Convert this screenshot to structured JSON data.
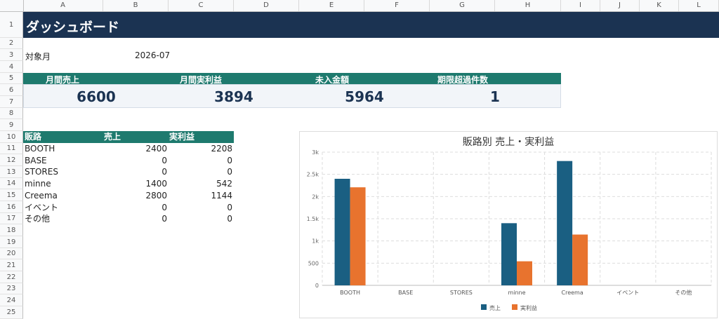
{
  "columns": [
    "A",
    "B",
    "C",
    "D",
    "E",
    "F",
    "G",
    "H",
    "I",
    "J",
    "K",
    "L"
  ],
  "rows": [
    "1",
    "2",
    "3",
    "4",
    "5",
    "6",
    "7",
    "8",
    "9",
    "10",
    "11",
    "12",
    "13",
    "14",
    "15",
    "16",
    "17",
    "18",
    "19",
    "20",
    "21",
    "22",
    "23",
    "24",
    "25"
  ],
  "dashboard": {
    "title": "ダッシュボード",
    "month_label": "対象月",
    "month_value": "2026-07"
  },
  "kpis": [
    {
      "label": "月間売上",
      "value": "6600"
    },
    {
      "label": "月間実利益",
      "value": "3894"
    },
    {
      "label": "未入金額",
      "value": "5964"
    },
    {
      "label": "期限超過件数",
      "value": "1"
    }
  ],
  "channel_table": {
    "headers": [
      "販路",
      "売上",
      "実利益"
    ],
    "rows": [
      {
        "name": "BOOTH",
        "sales": "2400",
        "profit": "2208"
      },
      {
        "name": "BASE",
        "sales": "0",
        "profit": "0"
      },
      {
        "name": "STORES",
        "sales": "0",
        "profit": "0"
      },
      {
        "name": "minne",
        "sales": "1400",
        "profit": "542"
      },
      {
        "name": "Creema",
        "sales": "2800",
        "profit": "1144"
      },
      {
        "name": "イベント",
        "sales": "0",
        "profit": "0"
      },
      {
        "name": "その他",
        "sales": "0",
        "profit": "0"
      }
    ]
  },
  "chart_data": {
    "type": "bar",
    "title": "販路別 売上・実利益",
    "categories": [
      "BOOTH",
      "BASE",
      "STORES",
      "minne",
      "Creema",
      "イベント",
      "その他"
    ],
    "series": [
      {
        "name": "売上",
        "values": [
          2400,
          0,
          0,
          1400,
          2800,
          0,
          0
        ],
        "color": "#1a5f82"
      },
      {
        "name": "実利益",
        "values": [
          2208,
          0,
          0,
          542,
          1144,
          0,
          0
        ],
        "color": "#e8732e"
      }
    ],
    "ylim": [
      0,
      3000
    ],
    "yticks": [
      "0",
      "500",
      "1k",
      "1.5k",
      "2k",
      "2.5k",
      "3k"
    ],
    "grid": true,
    "legend": "bottom"
  },
  "colors": {
    "title_bg": "#1b3352",
    "header_bg": "#1e7a6e",
    "kpi_value": "#1b3352"
  }
}
